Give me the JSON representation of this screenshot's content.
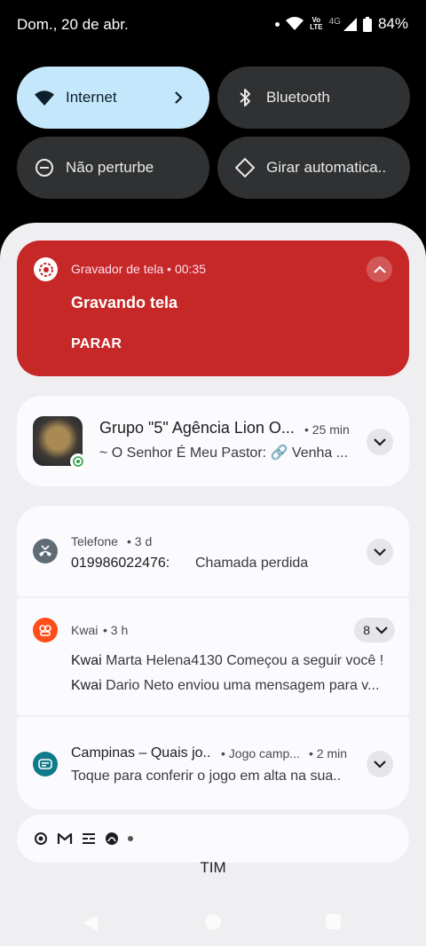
{
  "status_bar": {
    "date": "Dom., 20 de abr.",
    "network_type": "4G",
    "volte": "Vo\nLTE",
    "battery": "84%"
  },
  "quick_settings": {
    "internet": "Internet",
    "bluetooth": "Bluetooth",
    "dnd": "Não perturbe",
    "rotate": "Girar automatica.."
  },
  "screen_recorder": {
    "header": "Gravador de tela • 00:35",
    "title": "Gravando tela",
    "action": "PARAR"
  },
  "whatsapp": {
    "title": "Grupo \"5\" Agência Lion O...",
    "time": "• 25 min",
    "message": "~ O Senhor É Meu Pastor: 🔗 Venha ..."
  },
  "phone": {
    "app": "Telefone",
    "time": "• 3 d",
    "number": "019986022476:",
    "text": "Chamada perdida"
  },
  "kwai": {
    "app": "Kwai",
    "time": "• 3 h",
    "count": "8",
    "messages": [
      {
        "sender": "Kwai",
        "text": "Marta Helena4130 Começou a seguir você !"
      },
      {
        "sender": "Kwai",
        "text": "Dario Neto enviou uma mensagem para v..."
      }
    ]
  },
  "game": {
    "title": "Campinas – Quais jo..",
    "sub": "• Jogo camp...",
    "time": "• 2 min",
    "message": "Toque para conferir o jogo em alta na sua.."
  },
  "carrier": "TIM",
  "colors": {
    "recorder_bg": "#c62828",
    "tile_active": "#c4e7fb",
    "kwai_accent": "#ff4d1a",
    "game_accent": "#0f7a8a"
  }
}
